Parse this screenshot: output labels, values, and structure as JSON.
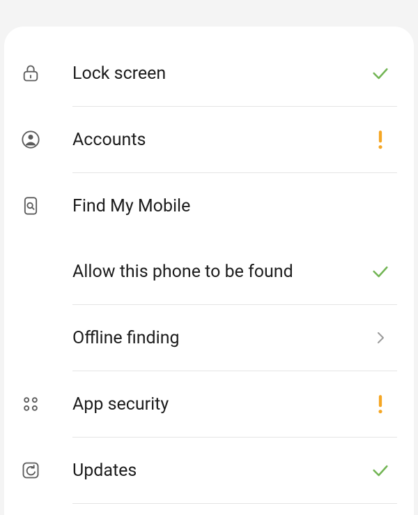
{
  "settings": {
    "items": [
      {
        "label": "Lock screen"
      },
      {
        "label": "Accounts"
      },
      {
        "label": "Find My Mobile"
      },
      {
        "label": "Allow this phone to be found"
      },
      {
        "label": "Offline finding"
      },
      {
        "label": "App security"
      },
      {
        "label": "Updates"
      }
    ]
  }
}
